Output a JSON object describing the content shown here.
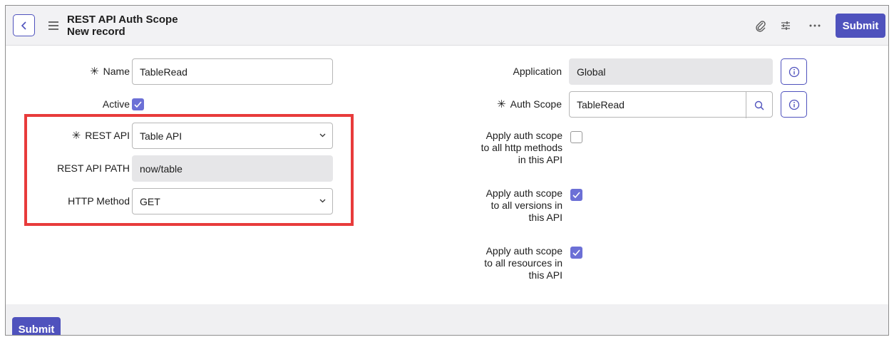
{
  "header": {
    "title": "REST API Auth Scope",
    "subtitle": "New record",
    "submit_label": "Submit",
    "icons": [
      "back-icon",
      "menu-icon",
      "paperclip-icon",
      "settings-sliders-icon",
      "more-icon"
    ]
  },
  "left": {
    "name_label": "Name",
    "name_value": "TableRead",
    "active_label": "Active",
    "active_checked": true,
    "rest_api_label": "REST API",
    "rest_api_value": "Table API",
    "rest_api_path_label": "REST API PATH",
    "rest_api_path_value": "now/table",
    "http_method_label": "HTTP Method",
    "http_method_value": "GET"
  },
  "right": {
    "application_label": "Application",
    "application_value": "Global",
    "auth_scope_label": "Auth Scope",
    "auth_scope_value": "TableRead",
    "apply_http_l1": "Apply auth scope",
    "apply_http_l2": "to all http methods",
    "apply_http_l3": "in this API",
    "apply_http_checked": false,
    "apply_versions_l1": "Apply auth scope",
    "apply_versions_l2": "to all versions in",
    "apply_versions_l3": "this API",
    "apply_versions_checked": true,
    "apply_resources_l1": "Apply auth scope",
    "apply_resources_l2": "to all resources in",
    "apply_resources_l3": "this API",
    "apply_resources_checked": true
  },
  "footer": {
    "submit_label": "Submit"
  },
  "colors": {
    "accent": "#4f52bd",
    "highlight": "#e83b3b",
    "checkbox": "#6c70d6"
  }
}
